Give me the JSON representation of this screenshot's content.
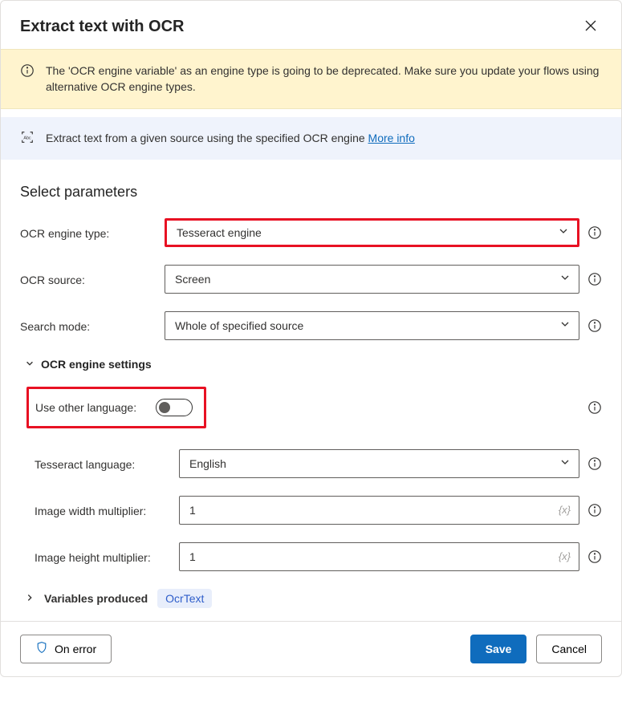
{
  "header": {
    "title": "Extract text with OCR"
  },
  "warning": {
    "text": "The 'OCR engine variable' as an engine type is going to be deprecated.  Make sure you update your flows using alternative OCR engine types."
  },
  "info": {
    "text": "Extract text from a given source using the specified OCR engine",
    "more": "More info"
  },
  "section_heading": "Select parameters",
  "fields": {
    "engine_type": {
      "label": "OCR engine type:",
      "value": "Tesseract engine"
    },
    "ocr_source": {
      "label": "OCR source:",
      "value": "Screen"
    },
    "search_mode": {
      "label": "Search mode:",
      "value": "Whole of specified source"
    }
  },
  "engine_settings": {
    "heading": "OCR engine settings",
    "use_other_language_label": "Use other language:",
    "tesseract_language": {
      "label": "Tesseract language:",
      "value": "English"
    },
    "width_mult": {
      "label": "Image width multiplier:",
      "value": "1",
      "token": "{x}"
    },
    "height_mult": {
      "label": "Image height multiplier:",
      "value": "1",
      "token": "{x}"
    }
  },
  "variables": {
    "label": "Variables produced",
    "badge": "OcrText"
  },
  "footer": {
    "on_error": "On error",
    "save": "Save",
    "cancel": "Cancel"
  }
}
